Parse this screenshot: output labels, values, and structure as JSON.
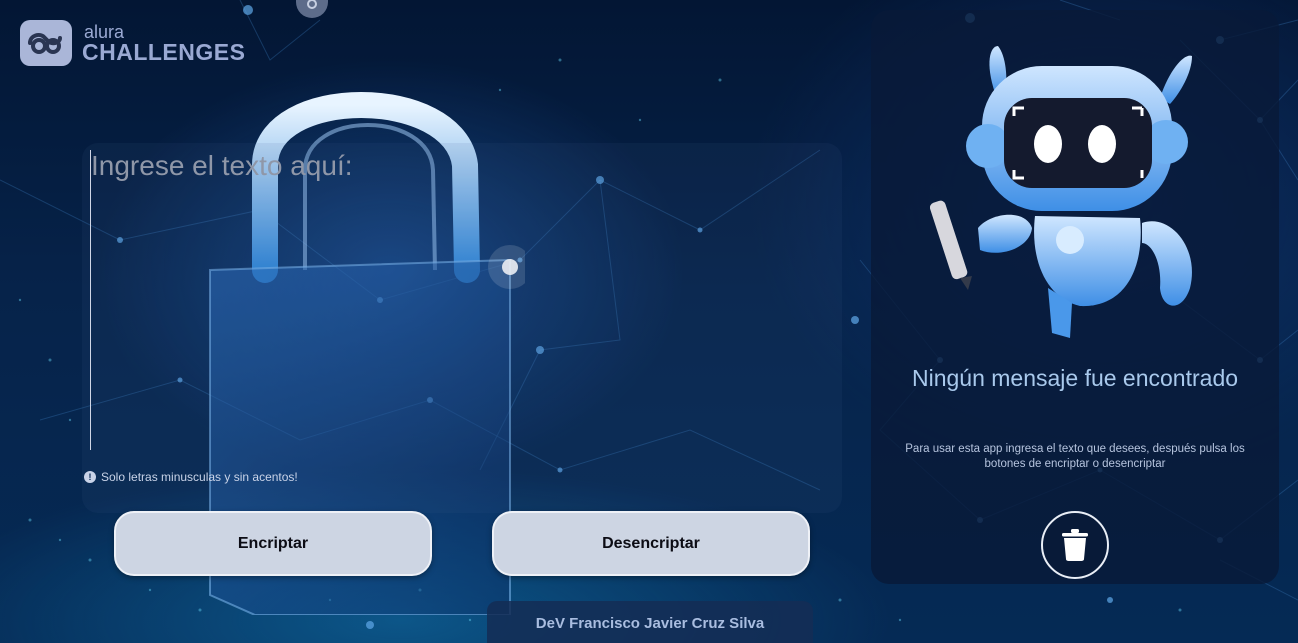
{
  "logo": {
    "line1": "alura",
    "line2": "CHALLENGES"
  },
  "input": {
    "placeholder": "Ingrese el texto aquí:",
    "value": ""
  },
  "hint": {
    "icon": "info-icon",
    "text": "Solo letras minusculas y sin acentos!"
  },
  "buttons": {
    "encrypt": "Encriptar",
    "decrypt": "Desencriptar"
  },
  "footer": {
    "credit": "DeV Francisco Javier Cruz Silva"
  },
  "output": {
    "title": "Ningún mensaje fue encontrado",
    "description": "Para usar esta app ingresa el texto que desees, después pulsa los botones de encriptar o desencriptar",
    "clear_icon": "trash-icon"
  },
  "colors": {
    "background": "#052a55",
    "button": "#cdd5e3",
    "title": "#a9c9ec",
    "panel": "#081a38"
  }
}
